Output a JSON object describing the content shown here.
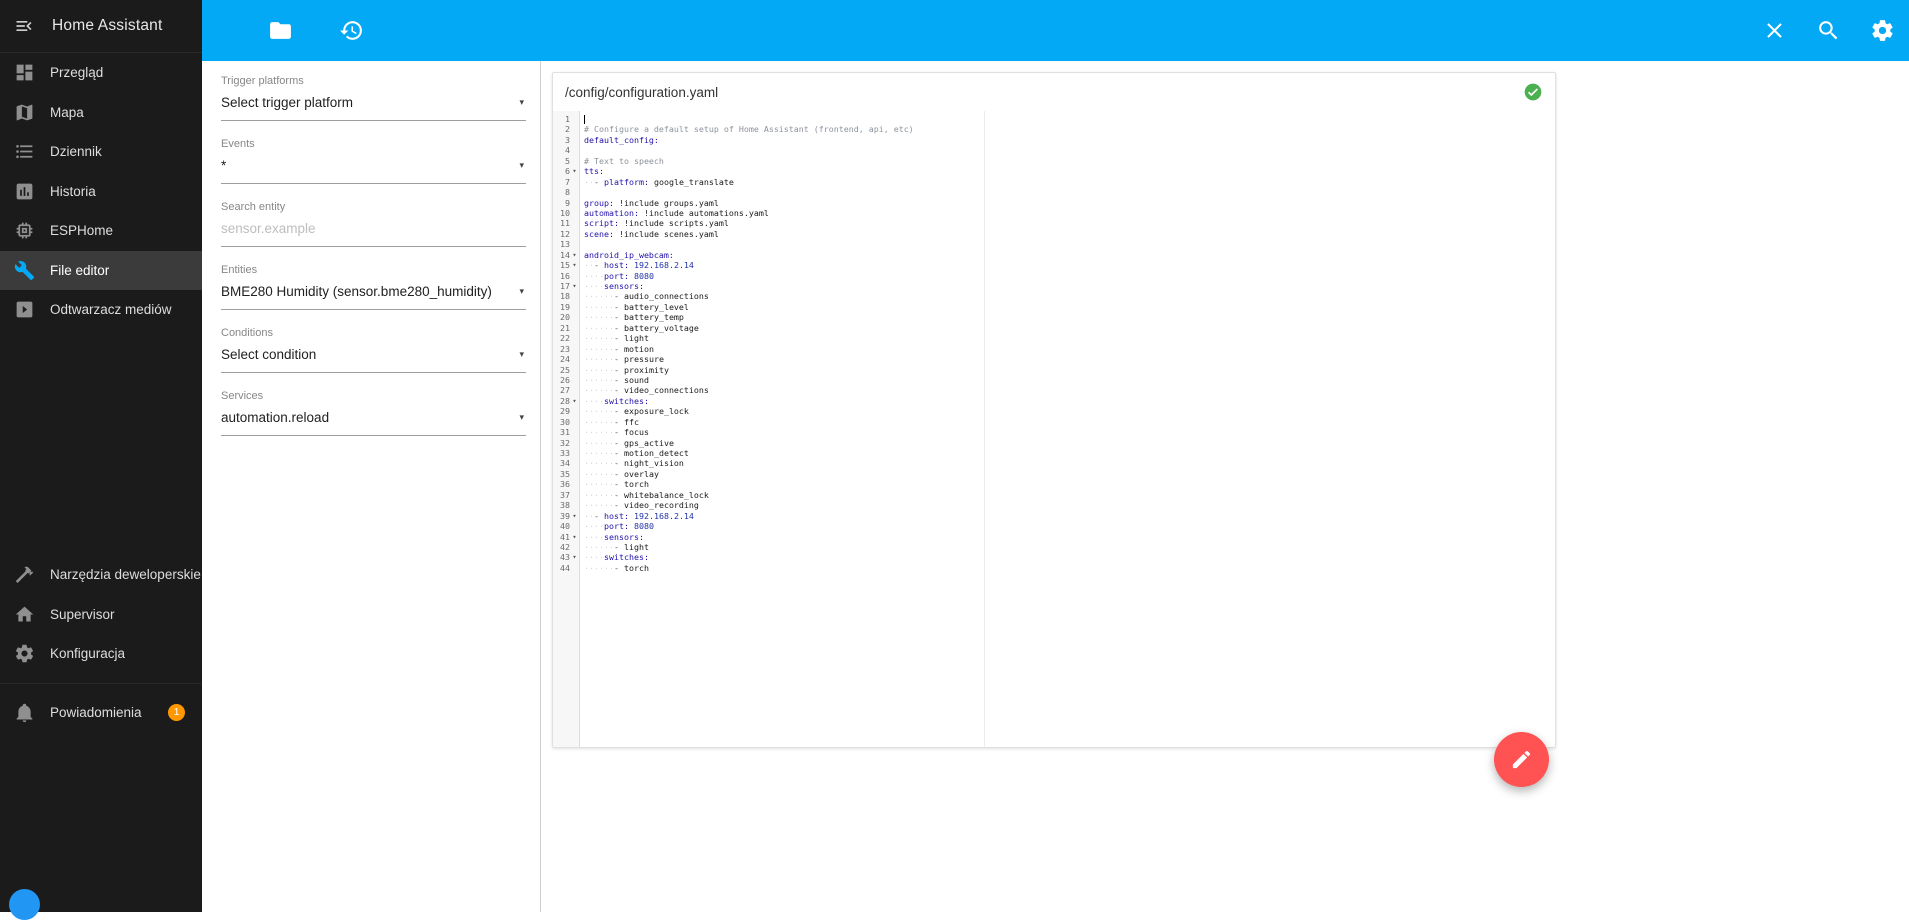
{
  "app": {
    "title": "Home Assistant"
  },
  "sidebar": {
    "items": [
      {
        "label": "Przegląd",
        "icon": "view-dashboard-icon",
        "selected": false
      },
      {
        "label": "Mapa",
        "icon": "map-icon",
        "selected": false
      },
      {
        "label": "Dziennik",
        "icon": "list-bulleted-icon",
        "selected": false
      },
      {
        "label": "Historia",
        "icon": "chart-box-icon",
        "selected": false
      },
      {
        "label": "ESPHome",
        "icon": "chip-icon",
        "selected": false
      },
      {
        "label": "File editor",
        "icon": "wrench-icon",
        "selected": true
      },
      {
        "label": "Odtwarzacz mediów",
        "icon": "play-box-icon",
        "selected": false
      }
    ],
    "bottom_items": [
      {
        "label": "Narzędzia deweloperskie",
        "icon": "hammer-icon",
        "selected": false
      },
      {
        "label": "Supervisor",
        "icon": "home-icon",
        "selected": false
      },
      {
        "label": "Konfiguracja",
        "icon": "gear-icon",
        "selected": false
      }
    ],
    "notification_item": {
      "label": "Powiadomienia",
      "icon": "bell-icon",
      "badge": "1",
      "selected": false
    }
  },
  "toolbar": {
    "left_icons": [
      "folder-icon",
      "history-icon"
    ],
    "right_icons": [
      "close-icon",
      "search-icon",
      "settings-icon"
    ],
    "color": "#03a9f4"
  },
  "panel": {
    "fields": [
      {
        "name": "trigger-platform-select",
        "label": "Trigger platforms",
        "value": "Select trigger platform",
        "placeholder": "",
        "dropdown": true
      },
      {
        "name": "events-select",
        "label": "Events",
        "value": "*",
        "placeholder": "",
        "dropdown": true
      },
      {
        "name": "search-entity-input",
        "label": "Search entity",
        "value": "",
        "placeholder": "sensor.example",
        "dropdown": false
      },
      {
        "name": "entities-select",
        "label": "Entities",
        "value": "BME280 Humidity (sensor.bme280_humidity)",
        "placeholder": "",
        "dropdown": true
      },
      {
        "name": "conditions-select",
        "label": "Conditions",
        "value": "Select condition",
        "placeholder": "",
        "dropdown": true
      },
      {
        "name": "services-select",
        "label": "Services",
        "value": "automation.reload",
        "placeholder": "",
        "dropdown": true
      }
    ]
  },
  "editor": {
    "filename": "/config/configuration.yaml",
    "status_icon": "check-circle-icon",
    "lines": [
      {
        "n": 1,
        "caret": true,
        "seg": []
      },
      {
        "n": 2,
        "seg": [
          [
            "com",
            "# Configure a default setup of Home Assistant (frontend, api, etc)"
          ]
        ]
      },
      {
        "n": 3,
        "seg": [
          [
            "key",
            "default_config:"
          ]
        ]
      },
      {
        "n": 4,
        "seg": []
      },
      {
        "n": 5,
        "seg": [
          [
            "com",
            "# Text to speech"
          ]
        ]
      },
      {
        "n": 6,
        "fold": true,
        "seg": [
          [
            "key",
            "tts:"
          ]
        ]
      },
      {
        "n": 7,
        "seg": [
          [
            "ws",
            "  "
          ],
          [
            "meta",
            "- "
          ],
          [
            "key",
            "platform:"
          ],
          [
            "txt",
            " google_translate"
          ]
        ]
      },
      {
        "n": 8,
        "seg": []
      },
      {
        "n": 9,
        "seg": [
          [
            "key",
            "group:"
          ],
          [
            "txt",
            " !include groups.yaml"
          ]
        ]
      },
      {
        "n": 10,
        "seg": [
          [
            "key",
            "automation:"
          ],
          [
            "txt",
            " !include automations.yaml"
          ]
        ]
      },
      {
        "n": 11,
        "seg": [
          [
            "key",
            "script:"
          ],
          [
            "txt",
            " !include scripts.yaml"
          ]
        ]
      },
      {
        "n": 12,
        "seg": [
          [
            "key",
            "scene:"
          ],
          [
            "txt",
            " !include scenes.yaml"
          ]
        ]
      },
      {
        "n": 13,
        "seg": []
      },
      {
        "n": 14,
        "fold": true,
        "seg": [
          [
            "key",
            "android_ip_webcam:"
          ]
        ]
      },
      {
        "n": 15,
        "fold": true,
        "seg": [
          [
            "ws",
            "  "
          ],
          [
            "meta",
            "- "
          ],
          [
            "key",
            "host:"
          ],
          [
            "txt",
            " "
          ],
          [
            "num",
            "192.168.2.14"
          ]
        ]
      },
      {
        "n": 16,
        "seg": [
          [
            "ws",
            "    "
          ],
          [
            "key",
            "port:"
          ],
          [
            "txt",
            " "
          ],
          [
            "num",
            "8080"
          ]
        ]
      },
      {
        "n": 17,
        "fold": true,
        "seg": [
          [
            "ws",
            "    "
          ],
          [
            "key",
            "sensors:"
          ]
        ]
      },
      {
        "n": 18,
        "seg": [
          [
            "ws",
            "      "
          ],
          [
            "meta",
            "- "
          ],
          [
            "txt",
            "audio_connections"
          ]
        ]
      },
      {
        "n": 19,
        "seg": [
          [
            "ws",
            "      "
          ],
          [
            "meta",
            "- "
          ],
          [
            "txt",
            "battery_level"
          ]
        ]
      },
      {
        "n": 20,
        "seg": [
          [
            "ws",
            "      "
          ],
          [
            "meta",
            "- "
          ],
          [
            "txt",
            "battery_temp"
          ]
        ]
      },
      {
        "n": 21,
        "seg": [
          [
            "ws",
            "      "
          ],
          [
            "meta",
            "- "
          ],
          [
            "txt",
            "battery_voltage"
          ]
        ]
      },
      {
        "n": 22,
        "seg": [
          [
            "ws",
            "      "
          ],
          [
            "meta",
            "- "
          ],
          [
            "txt",
            "light"
          ]
        ]
      },
      {
        "n": 23,
        "seg": [
          [
            "ws",
            "      "
          ],
          [
            "meta",
            "- "
          ],
          [
            "txt",
            "motion"
          ]
        ]
      },
      {
        "n": 24,
        "seg": [
          [
            "ws",
            "      "
          ],
          [
            "meta",
            "- "
          ],
          [
            "txt",
            "pressure"
          ]
        ]
      },
      {
        "n": 25,
        "seg": [
          [
            "ws",
            "      "
          ],
          [
            "meta",
            "- "
          ],
          [
            "txt",
            "proximity"
          ]
        ]
      },
      {
        "n": 26,
        "seg": [
          [
            "ws",
            "      "
          ],
          [
            "meta",
            "- "
          ],
          [
            "txt",
            "sound"
          ]
        ]
      },
      {
        "n": 27,
        "seg": [
          [
            "ws",
            "      "
          ],
          [
            "meta",
            "- "
          ],
          [
            "txt",
            "video_connections"
          ]
        ]
      },
      {
        "n": 28,
        "fold": true,
        "seg": [
          [
            "ws",
            "    "
          ],
          [
            "key",
            "switches:"
          ]
        ]
      },
      {
        "n": 29,
        "seg": [
          [
            "ws",
            "      "
          ],
          [
            "meta",
            "- "
          ],
          [
            "txt",
            "exposure_lock"
          ]
        ]
      },
      {
        "n": 30,
        "seg": [
          [
            "ws",
            "      "
          ],
          [
            "meta",
            "- "
          ],
          [
            "txt",
            "ffc"
          ]
        ]
      },
      {
        "n": 31,
        "seg": [
          [
            "ws",
            "      "
          ],
          [
            "meta",
            "- "
          ],
          [
            "txt",
            "focus"
          ]
        ]
      },
      {
        "n": 32,
        "seg": [
          [
            "ws",
            "      "
          ],
          [
            "meta",
            "- "
          ],
          [
            "txt",
            "gps_active"
          ]
        ]
      },
      {
        "n": 33,
        "seg": [
          [
            "ws",
            "      "
          ],
          [
            "meta",
            "- "
          ],
          [
            "txt",
            "motion_detect"
          ]
        ]
      },
      {
        "n": 34,
        "seg": [
          [
            "ws",
            "      "
          ],
          [
            "meta",
            "- "
          ],
          [
            "txt",
            "night_vision"
          ]
        ]
      },
      {
        "n": 35,
        "seg": [
          [
            "ws",
            "      "
          ],
          [
            "meta",
            "- "
          ],
          [
            "txt",
            "overlay"
          ]
        ]
      },
      {
        "n": 36,
        "seg": [
          [
            "ws",
            "      "
          ],
          [
            "meta",
            "- "
          ],
          [
            "txt",
            "torch"
          ]
        ]
      },
      {
        "n": 37,
        "seg": [
          [
            "ws",
            "      "
          ],
          [
            "meta",
            "- "
          ],
          [
            "txt",
            "whitebalance_lock"
          ]
        ]
      },
      {
        "n": 38,
        "seg": [
          [
            "ws",
            "      "
          ],
          [
            "meta",
            "- "
          ],
          [
            "txt",
            "video_recording"
          ]
        ]
      },
      {
        "n": 39,
        "fold": true,
        "seg": [
          [
            "ws",
            "  "
          ],
          [
            "meta",
            "- "
          ],
          [
            "key",
            "host:"
          ],
          [
            "txt",
            " "
          ],
          [
            "num",
            "192.168.2.14"
          ]
        ]
      },
      {
        "n": 40,
        "seg": [
          [
            "ws",
            "    "
          ],
          [
            "key",
            "port:"
          ],
          [
            "txt",
            " "
          ],
          [
            "num",
            "8080"
          ]
        ]
      },
      {
        "n": 41,
        "fold": true,
        "seg": [
          [
            "ws",
            "    "
          ],
          [
            "key",
            "sensors:"
          ]
        ]
      },
      {
        "n": 42,
        "seg": [
          [
            "ws",
            "      "
          ],
          [
            "meta",
            "- "
          ],
          [
            "txt",
            "light"
          ]
        ]
      },
      {
        "n": 43,
        "fold": true,
        "seg": [
          [
            "ws",
            "    "
          ],
          [
            "key",
            "switches:"
          ]
        ]
      },
      {
        "n": 44,
        "seg": [
          [
            "ws",
            "      "
          ],
          [
            "meta",
            "- "
          ],
          [
            "txt",
            "torch"
          ]
        ]
      }
    ]
  },
  "fab": {
    "icon": "pencil-icon",
    "color": "#ff5252"
  },
  "colors": {
    "toolbar": "#03a9f4",
    "accent": "#03a9f4",
    "badge": "#ff9800",
    "saved": "#4caf50",
    "fab": "#ff5252",
    "avatar": "#2196f3",
    "sidebar_bg": "#1b1b1b"
  }
}
